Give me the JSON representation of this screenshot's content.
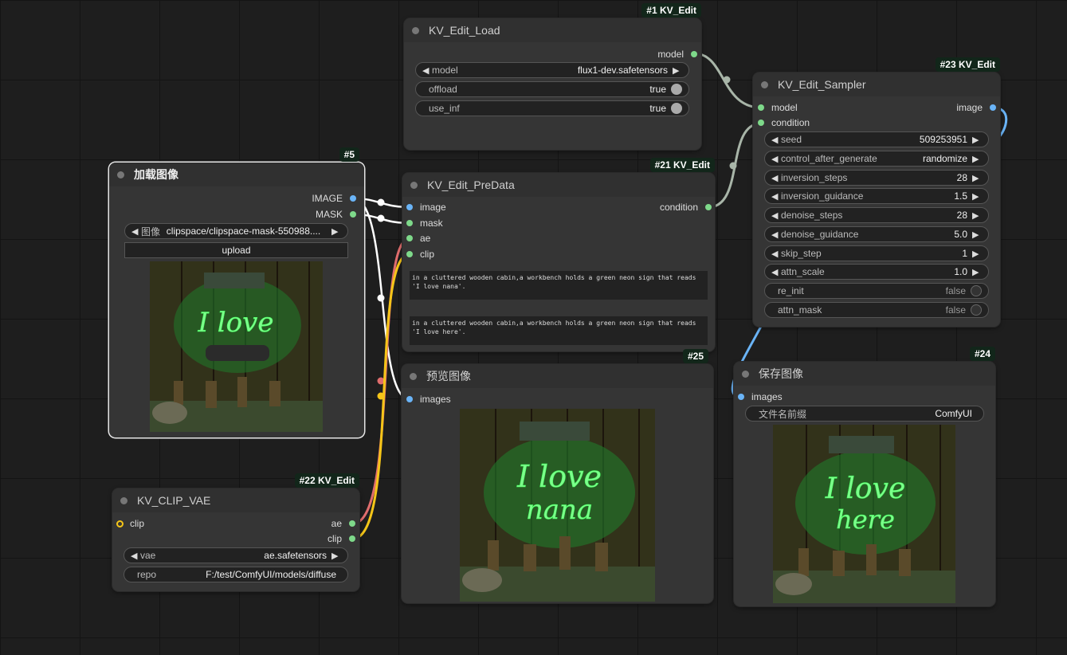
{
  "nodes": {
    "load": {
      "badge": "#1 KV_Edit",
      "title": "KV_Edit_Load",
      "outputs": [
        "model"
      ],
      "widgets": [
        {
          "label": "model",
          "value": "flux1-dev.safetensors"
        },
        {
          "label": "offload",
          "value": "true"
        },
        {
          "label": "use_inf",
          "value": "true"
        }
      ]
    },
    "sampler": {
      "badge": "#23 KV_Edit",
      "title": "KV_Edit_Sampler",
      "inputs": [
        "model",
        "condition"
      ],
      "outputs": [
        "image"
      ],
      "widgets": [
        {
          "label": "seed",
          "value": "509253951"
        },
        {
          "label": "control_after_generate",
          "value": "randomize"
        },
        {
          "label": "inversion_steps",
          "value": "28"
        },
        {
          "label": "inversion_guidance",
          "value": "1.5"
        },
        {
          "label": "denoise_steps",
          "value": "28"
        },
        {
          "label": "denoise_guidance",
          "value": "5.0"
        },
        {
          "label": "skip_step",
          "value": "1"
        },
        {
          "label": "attn_scale",
          "value": "1.0"
        },
        {
          "label": "re_init",
          "value": "false"
        },
        {
          "label": "attn_mask",
          "value": "false"
        }
      ]
    },
    "loadimage": {
      "badge": "#5",
      "title": "加载图像",
      "outputs": [
        "IMAGE",
        "MASK"
      ],
      "image_widget": {
        "label": "图像",
        "value": "clipspace/clipspace-mask-550988...."
      },
      "upload": "upload"
    },
    "predata": {
      "badge": "#21 KV_Edit",
      "title": "KV_Edit_PreData",
      "inputs": [
        "image",
        "mask",
        "ae",
        "clip"
      ],
      "outputs": [
        "condition"
      ],
      "text1": "in a cluttered wooden cabin,a workbench holds a green neon sign that reads 'I love nana'.",
      "text2": "in a cluttered wooden cabin,a workbench holds a green neon sign that reads 'I love here'."
    },
    "preview": {
      "badge": "#25",
      "title": "预览图像",
      "inputs": [
        "images"
      ],
      "image_text": [
        "I love",
        "nana"
      ]
    },
    "save": {
      "badge": "#24",
      "title": "保存图像",
      "inputs": [
        "images"
      ],
      "widgets": [
        {
          "label": "文件名前缀",
          "value": "ComfyUI"
        }
      ],
      "image_text": [
        "I love",
        "here"
      ]
    },
    "clipvae": {
      "badge": "#22 KV_Edit",
      "title": "KV_CLIP_VAE",
      "inputs": [
        "clip"
      ],
      "outputs": [
        "ae",
        "clip"
      ],
      "widgets": [
        {
          "label": "vae",
          "value": "ae.safetensors"
        },
        {
          "label": "repo",
          "value": "F:/test/ComfyUI/models/diffuse"
        }
      ]
    }
  },
  "load_image_text": "I love",
  "colors": {
    "model_link": "#a8b5a8",
    "image_link": "#ffffff",
    "ae_link": "#e06d6d",
    "clip_link": "#f5c518",
    "image_out_link": "#6ab4f7"
  }
}
